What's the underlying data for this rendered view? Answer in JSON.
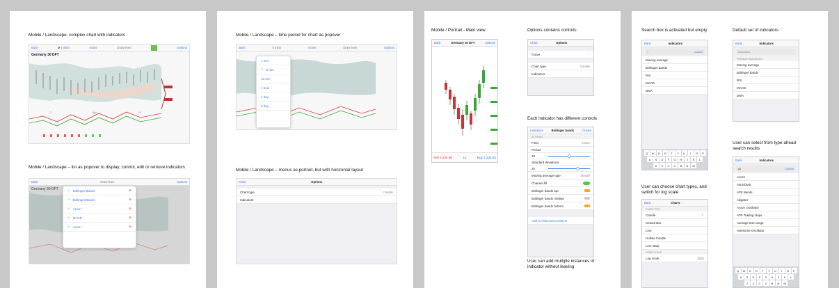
{
  "p1": {
    "cap1": "Mobile / Landscape, complex chart with indicators",
    "cap2": "Mobile / Landscape – list as popover to display, control, edit or remove indicators",
    "shot1": {
      "back": "Back",
      "period": "5 mins",
      "active": "Active",
      "draw": "Draw lines",
      "options": "Options",
      "instrument": "Germany 30 DFT",
      "xticks": [
        "2",
        "Apr",
        "14"
      ]
    },
    "shot2": {
      "back": "Back",
      "instrument": "Germany 30 DFT",
      "options": "Options",
      "draw": "Draw lines",
      "indicators": [
        "Bollinger Bands",
        "Bollinger Bands",
        "Aroon",
        "MACD",
        "Aroon"
      ]
    }
  },
  "p2": {
    "cap1": "Mobile / Landscape – time period for chart as popover",
    "cap2": "Mobile / Landscape – menus as portrait, but with horizontal layout",
    "shot1": {
      "back": "Back",
      "period": "5 mins",
      "active": "Active",
      "draw": "Draw lines",
      "options": "Options",
      "periods": [
        "1 min",
        "5 min",
        "15 min",
        "1 hour",
        "1 day",
        "5 day"
      ]
    },
    "shot2": {
      "back": "Chart",
      "title": "Options",
      "row1_label": "Chart type",
      "row1_value": "Candle",
      "row2_label": "Indicators"
    }
  },
  "p3": {
    "cap_main": "Mobile / Portrait - Main view",
    "cap_options": "Options contains controls",
    "cap_each": "Each indicator has different controls",
    "cap_multi": "User can add multiple instances of indicator without leaving",
    "main": {
      "back": "Back",
      "instrument": "Germany 30 DFT",
      "options": "Options",
      "sell_label": "Sell",
      "sell": "1,234.56",
      "qty": "15",
      "buy_label": "Buy",
      "buy": "1,234.63"
    },
    "options": {
      "back": "Chart",
      "title": "Options",
      "active": "Active",
      "chart_type": "Chart type",
      "chart_type_value": "Candle",
      "indicators": "Indicators"
    },
    "bb": {
      "back": "Indicators",
      "title": "Bollinger bands",
      "create": "Create",
      "section": "SETTINGS",
      "field": "Field",
      "field_value": "Close",
      "period": "Period",
      "period_value": "20",
      "std": "Standard deviations",
      "std_value": "20",
      "mat": "Moving average type",
      "mat_value": "Simple",
      "channel": "Channel fill",
      "top": "Bollinger bands top",
      "median": "Bollinger bands median",
      "bottom": "Bollinger bands bottom",
      "add": "Add to chart and continue"
    }
  },
  "p4": {
    "cap_search": "Search box is activated but empty",
    "cap_default": "Default set of indicators",
    "cap_types": "User can choose chart types, and switch for log scale",
    "cap_type_ahead": "User can select from type-ahead search results",
    "search": {
      "back": "Back",
      "title": "Indicators",
      "cancel": "Cancel",
      "items": [
        "Moving average",
        "Bollinger bands",
        "RSI",
        "MACD",
        "DMA"
      ]
    },
    "default": {
      "back": "Back",
      "title": "Indicators",
      "placeholder": "Indicators",
      "section": "POPULAR INDICATORS",
      "items": [
        "Moving average",
        "Bollinger bands",
        "RSI",
        "MACD",
        "DMA"
      ]
    },
    "charts": {
      "back": "Back",
      "title": "Charts",
      "section": "CHART TYPE",
      "items": [
        "Candle",
        "Closed Bar",
        "Line",
        "Hollow Candle",
        "Line stats"
      ],
      "section2": "CHART SCALE",
      "log": "Log scale"
    },
    "typeahead": {
      "back": "Back",
      "title": "Indicators",
      "query": "Al",
      "cancel": "Cancel",
      "items": [
        "Aroon",
        "ADX/DMS",
        "ATR Bands",
        "Alligator",
        "Aroon Oscillator",
        "ATR Trailing stops",
        "Average true range",
        "Awesome Oscillator"
      ]
    },
    "keys": [
      "QWERTYUIOP",
      "ASDFGHJKL",
      "ZXCVBNM"
    ]
  }
}
